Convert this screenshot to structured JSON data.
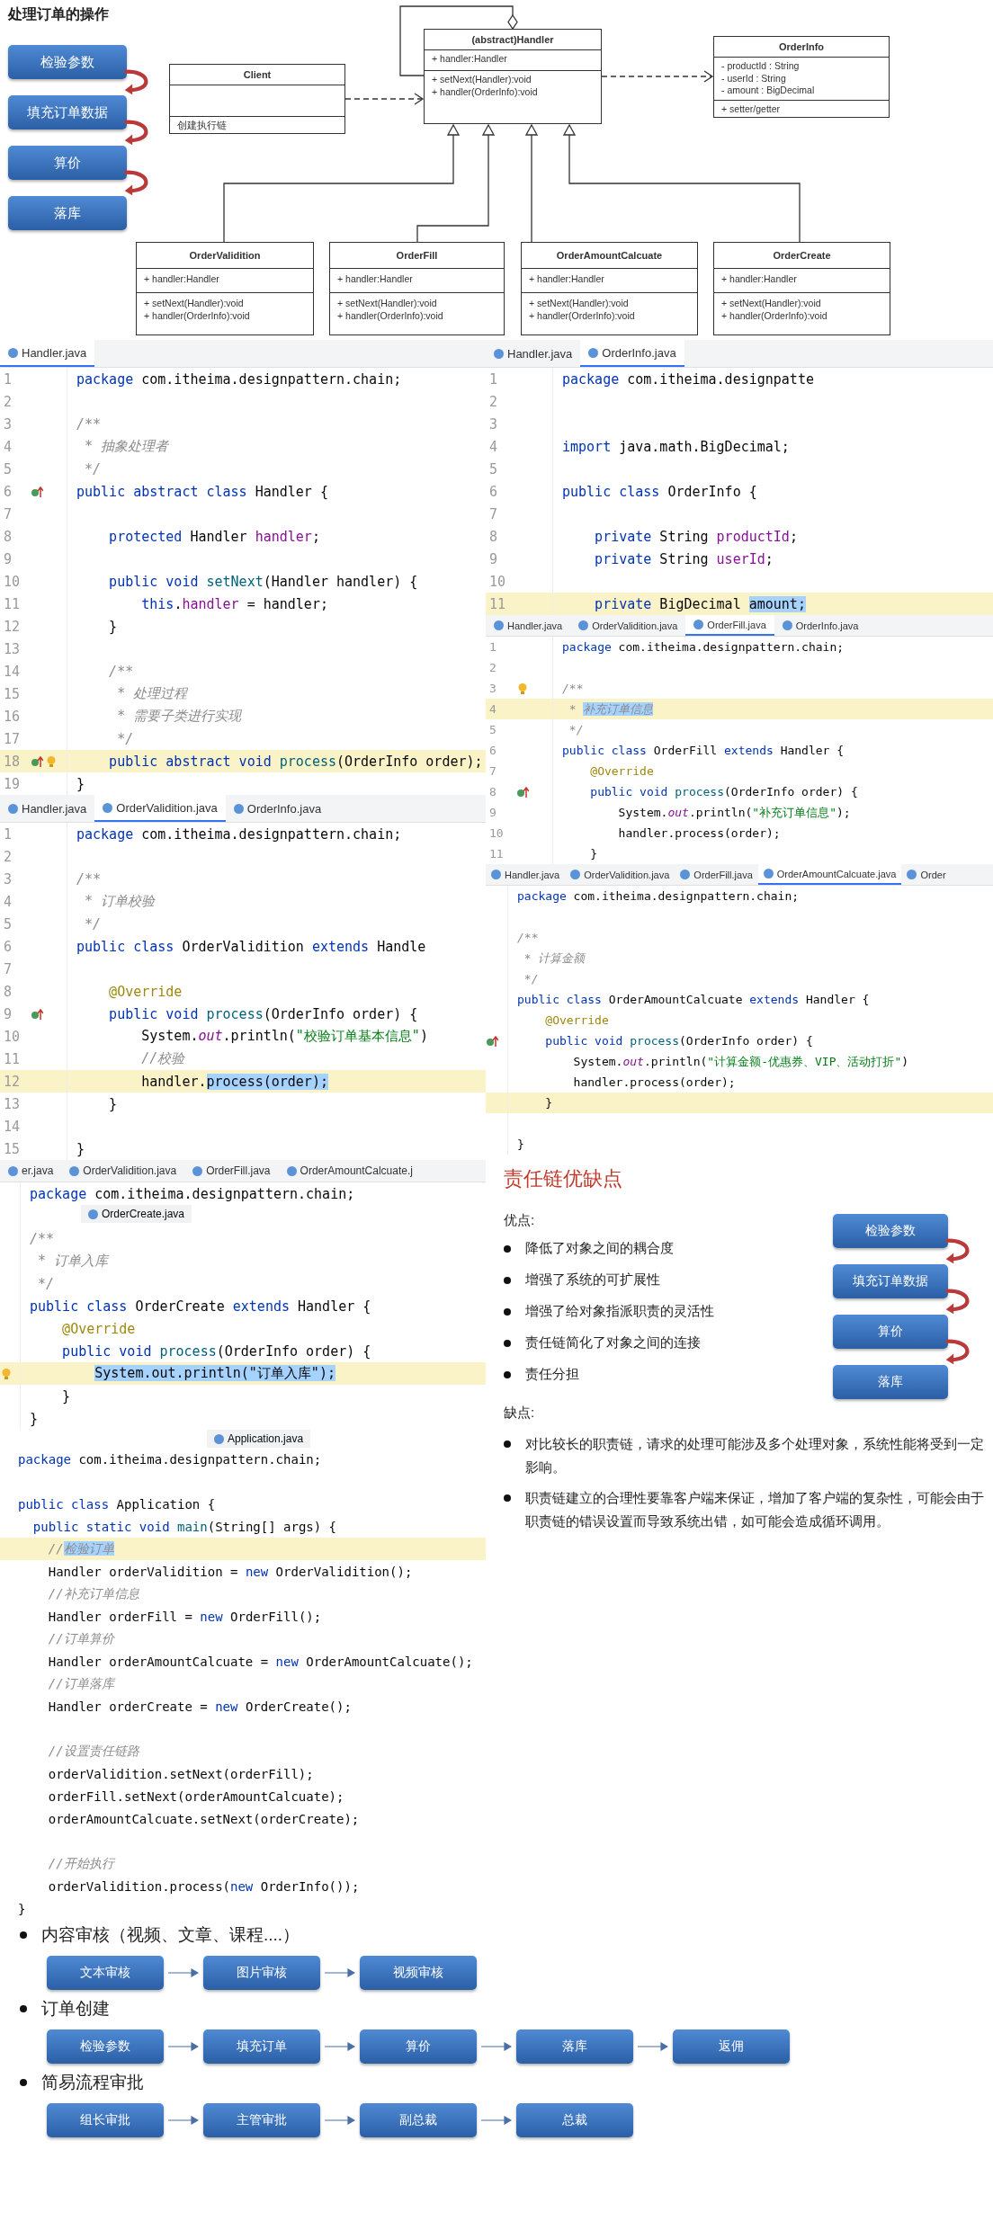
{
  "diagram": {
    "title": "处理订单的操作",
    "steps": [
      "检验参数",
      "填充订单数据",
      "算价",
      "落库"
    ],
    "classes": [
      {
        "name": "(abstract)Handler",
        "fields": [
          "+ handler:Handler"
        ],
        "methods": [
          "+ setNext(Handler):void",
          "+ handler(OrderInfo):void"
        ]
      },
      {
        "name": "Client",
        "methods": [
          "创建执行链"
        ]
      },
      {
        "name": "OrderInfo",
        "fields": [
          "- productId : String",
          "- userId : String",
          "- amount : BigDecimal"
        ],
        "methods": [
          "+ setter/getter"
        ]
      },
      {
        "name": "OrderValidition",
        "fields": [
          "+ handler:Handler"
        ],
        "methods": [
          "+ setNext(Handler):void",
          "+ handler(OrderInfo):void"
        ]
      },
      {
        "name": "OrderFill",
        "fields": [
          "+ handler:Handler"
        ],
        "methods": [
          "+ setNext(Handler):void",
          "+ handler(OrderInfo):void"
        ]
      },
      {
        "name": "OrderAmountCalcuate",
        "fields": [
          "+ handler:Handler"
        ],
        "methods": [
          "+ setNext(Handler):void",
          "+ handler(OrderInfo):void"
        ]
      },
      {
        "name": "OrderCreate",
        "fields": [
          "+ handler:Handler"
        ],
        "methods": [
          "+ setNext(Handler):void",
          "+ handler(OrderInfo):void"
        ]
      }
    ]
  },
  "left_column": {
    "editors": [
      {
        "tabs": [
          {
            "label": "Handler.java",
            "selected": true
          }
        ],
        "lines": [
          {
            "number": "1",
            "highlighted": false,
            "code": [
              {
                "kind": "keyword",
                "text": "package"
              },
              {
                "text": " com.itheima.designpattern.chain;"
              }
            ]
          },
          {
            "number": "2",
            "highlighted": false
          },
          {
            "number": "3",
            "highlighted": false,
            "code": [
              {
                "kind": "comment",
                "text": "/**"
              }
            ]
          },
          {
            "number": "4",
            "highlighted": false,
            "code": [
              {
                "kind": "comment",
                "text": " * 抽象处理者"
              }
            ]
          },
          {
            "number": "5",
            "highlighted": false,
            "code": [
              {
                "kind": "comment",
                "text": " */"
              }
            ]
          },
          {
            "number": "6",
            "highlighted": false,
            "markers": [
              {
                "kind": "override"
              }
            ],
            "code": [
              {
                "kind": "keyword",
                "text": "public abstract class"
              },
              {
                "text": " Handler {"
              }
            ]
          },
          {
            "number": "7",
            "highlighted": false
          },
          {
            "number": "8",
            "highlighted": false,
            "code": [
              {
                "kind": "keyword",
                "text": "    protected"
              },
              {
                "text": " Handler "
              },
              {
                "kind": "field",
                "text": "handler"
              },
              {
                "text": ";"
              }
            ]
          },
          {
            "number": "9",
            "highlighted": false
          },
          {
            "number": "10",
            "highlighted": false,
            "code": [
              {
                "kind": "keyword",
                "text": "    public void"
              },
              {
                "kind": "method",
                "text": " setNext"
              },
              {
                "text": "(Handler handler) {"
              }
            ]
          },
          {
            "number": "11",
            "highlighted": false,
            "code": [
              {
                "kind": "keyword",
                "text": "        this"
              },
              {
                "text": "."
              },
              {
                "kind": "field",
                "text": "handler"
              },
              {
                "text": " = handler;"
              }
            ]
          },
          {
            "number": "12",
            "highlighted": false,
            "code": [
              {
                "text": "    }"
              }
            ]
          },
          {
            "number": "13",
            "highlighted": false
          },
          {
            "number": "14",
            "highlighted": false,
            "code": [
              {
                "kind": "comment",
                "text": "    /**"
              }
            ]
          },
          {
            "number": "15",
            "highlighted": false,
            "code": [
              {
                "kind": "comment",
                "text": "     * 处理过程"
              }
            ]
          },
          {
            "number": "16",
            "highlighted": false,
            "code": [
              {
                "kind": "comment",
                "text": "     * 需要子类进行实现"
              }
            ]
          },
          {
            "number": "17",
            "highlighted": false,
            "code": [
              {
                "kind": "comment",
                "text": "     */"
              }
            ]
          },
          {
            "number": "18",
            "highlighted": true,
            "markers": [
              {
                "kind": "override"
              },
              {
                "kind": "bulb"
              }
            ],
            "code": [
              {
                "kind": "keyword",
                "text": "    public abstract void"
              },
              {
                "kind": "method",
                "text": " process"
              },
              {
                "text": "(OrderInfo order);"
              }
            ]
          },
          {
            "number": "19",
            "highlighted": false,
            "code": [
              {
                "text": "}"
              }
            ]
          }
        ]
      },
      {
        "tabs": [
          {
            "label": "Handler.java",
            "selected": false
          },
          {
            "label": "OrderValidition.java",
            "selected": true
          },
          {
            "label": "OrderInfo.java",
            "selected": false
          }
        ],
        "lines": [
          {
            "number": "1",
            "highlighted": false,
            "code": [
              {
                "kind": "keyword",
                "text": "package"
              },
              {
                "text": " com.itheima.designpattern.chain;"
              }
            ]
          },
          {
            "number": "2",
            "highlighted": false
          },
          {
            "number": "3",
            "highlighted": false,
            "code": [
              {
                "kind": "comment",
                "text": "/**"
              }
            ]
          },
          {
            "number": "4",
            "highlighted": false,
            "code": [
              {
                "kind": "comment",
                "text": " * 订单校验"
              }
            ]
          },
          {
            "number": "5",
            "highlighted": false,
            "code": [
              {
                "kind": "comment",
                "text": " */"
              }
            ]
          },
          {
            "number": "6",
            "highlighted": false,
            "code": [
              {
                "kind": "keyword",
                "text": "public class"
              },
              {
                "text": " OrderValidition "
              },
              {
                "kind": "keyword",
                "text": "extends"
              },
              {
                "text": " Handle"
              }
            ]
          },
          {
            "number": "7",
            "highlighted": false
          },
          {
            "number": "8",
            "highlighted": false,
            "code": [
              {
                "kind": "annotation",
                "text": "    @Override"
              }
            ]
          },
          {
            "number": "9",
            "highlighted": false,
            "markers": [
              {
                "kind": "override"
              }
            ],
            "code": [
              {
                "kind": "keyword",
                "text": "    public void"
              },
              {
                "kind": "method",
                "text": " process"
              },
              {
                "text": "(OrderInfo order) {"
              }
            ]
          },
          {
            "number": "10",
            "highlighted": false,
            "code": [
              {
                "text": "        System."
              },
              {
                "kind": "static",
                "text": "out"
              },
              {
                "text": ".println("
              },
              {
                "kind": "string",
                "text": "\"校验订单基本信息\""
              },
              {
                "text": ")"
              }
            ]
          },
          {
            "number": "11",
            "highlighted": false,
            "code": [
              {
                "kind": "comment",
                "text": "        //校验"
              }
            ]
          },
          {
            "number": "12",
            "highlighted": true,
            "code": [
              {
                "text": "        handler."
              },
              {
                "kind": "selection",
                "text": "process(order);"
              }
            ]
          },
          {
            "number": "13",
            "highlighted": false,
            "code": [
              {
                "text": "    }"
              }
            ]
          },
          {
            "number": "14",
            "highlighted": false
          },
          {
            "number": "15",
            "highlighted": false,
            "code": [
              {
                "text": "}"
              }
            ]
          }
        ]
      },
      {
        "tabs": [
          {
            "label": "er.java",
            "selected": false
          },
          {
            "label": "OrderValidition.java",
            "selected": false
          },
          {
            "label": "OrderFill.java",
            "selected": false
          },
          {
            "label": "OrderAmountCalcuate.j",
            "selected": false
          }
        ],
        "floating_tab": "OrderCreate.java",
        "lines": [
          {
            "highlighted": false,
            "code": [
              {
                "kind": "keyword",
                "text": "package"
              },
              {
                "text": " com.itheima.designpattern.chain;"
              }
            ]
          },
          {
            "highlighted": false
          },
          {
            "highlighted": false,
            "code": [
              {
                "kind": "comment",
                "text": "/**"
              }
            ]
          },
          {
            "highlighted": false,
            "code": [
              {
                "kind": "comment",
                "text": " * 订单入库"
              }
            ]
          },
          {
            "highlighted": false,
            "code": [
              {
                "kind": "comment",
                "text": " */"
              }
            ]
          },
          {
            "highlighted": false,
            "code": [
              {
                "kind": "keyword",
                "text": "public class"
              },
              {
                "text": " OrderCreate "
              },
              {
                "kind": "keyword",
                "text": "extends"
              },
              {
                "text": " Handler {"
              }
            ]
          },
          {
            "highlighted": false,
            "code": [
              {
                "kind": "annotation",
                "text": "    @Override"
              }
            ]
          },
          {
            "highlighted": false,
            "code": [
              {
                "kind": "keyword",
                "text": "    public void"
              },
              {
                "kind": "method",
                "text": " process"
              },
              {
                "text": "(OrderInfo order) {"
              }
            ]
          },
          {
            "highlighted": true,
            "markers": [
              {
                "kind": "bulb"
              }
            ],
            "code": [
              {
                "kind": "selection",
                "text": "        System.out.println(\"订单入库\");"
              }
            ]
          },
          {
            "highlighted": false,
            "code": [
              {
                "text": "    }"
              }
            ]
          },
          {
            "highlighted": false,
            "code": [
              {
                "text": "}"
              }
            ]
          }
        ]
      },
      {
        "floating_tab": "Application.java",
        "lines": [
          {
            "highlighted": false,
            "code": [
              {
                "kind": "keyword",
                "text": "package"
              },
              {
                "text": " com.itheima.designpattern.chain;"
              }
            ]
          },
          {
            "highlighted": false
          },
          {
            "highlighted": false,
            "code": [
              {
                "kind": "keyword",
                "text": "public class"
              },
              {
                "text": " Application {"
              }
            ]
          },
          {
            "highlighted": false,
            "code": [
              {
                "kind": "keyword",
                "text": "  public static void"
              },
              {
                "kind": "method",
                "text": " main"
              },
              {
                "text": "(String[] args) {"
              }
            ]
          },
          {
            "highlighted": true,
            "code": [
              {
                "kind": "comment",
                "text": "    //"
              },
              {
                "kind": "commentselection",
                "text": "检验订单"
              }
            ]
          },
          {
            "highlighted": false,
            "code": [
              {
                "text": "    Handler orderValidition = "
              },
              {
                "kind": "keyword",
                "text": "new"
              },
              {
                "text": " OrderValidition();"
              }
            ]
          },
          {
            "highlighted": false,
            "code": [
              {
                "kind": "comment",
                "text": "    //补充订单信息"
              }
            ]
          },
          {
            "highlighted": false,
            "code": [
              {
                "text": "    Handler orderFill = "
              },
              {
                "kind": "keyword",
                "text": "new"
              },
              {
                "text": " OrderFill();"
              }
            ]
          },
          {
            "highlighted": false,
            "code": [
              {
                "kind": "comment",
                "text": "    //订单算价"
              }
            ]
          },
          {
            "highlighted": false,
            "code": [
              {
                "text": "    Handler orderAmountCalcuate = "
              },
              {
                "kind": "keyword",
                "text": "new"
              },
              {
                "text": " OrderAmountCalcuate();"
              }
            ]
          },
          {
            "highlighted": false,
            "code": [
              {
                "kind": "comment",
                "text": "    //订单落库"
              }
            ]
          },
          {
            "highlighted": false,
            "code": [
              {
                "text": "    Handler orderCreate = "
              },
              {
                "kind": "keyword",
                "text": "new"
              },
              {
                "text": " OrderCreate();"
              }
            ]
          },
          {
            "highlighted": false
          },
          {
            "highlighted": false,
            "code": [
              {
                "kind": "comment",
                "text": "    //设置责任链路"
              }
            ]
          },
          {
            "highlighted": false,
            "code": [
              {
                "text": "    orderValidition.setNext(orderFill);"
              }
            ]
          },
          {
            "highlighted": false,
            "code": [
              {
                "text": "    orderFill.setNext(orderAmountCalcuate);"
              }
            ]
          },
          {
            "highlighted": false,
            "code": [
              {
                "text": "    orderAmountCalcuate.setNext(orderCreate);"
              }
            ]
          },
          {
            "highlighted": false
          },
          {
            "highlighted": false,
            "code": [
              {
                "kind": "comment",
                "text": "    //开始执行"
              }
            ]
          },
          {
            "highlighted": false,
            "code": [
              {
                "text": "    orderValidition.process("
              },
              {
                "kind": "keyword",
                "text": "new"
              },
              {
                "text": " OrderInfo());"
              }
            ]
          },
          {
            "highlighted": false,
            "code": [
              {
                "text": "}"
              }
            ]
          }
        ]
      }
    ]
  },
  "right_column": {
    "editors": [
      {
        "tabs": [
          {
            "label": "Handler.java",
            "selected": false
          },
          {
            "label": "OrderInfo.java",
            "selected": true
          }
        ],
        "lines": [
          {
            "number": "1",
            "highlighted": false,
            "code": [
              {
                "kind": "keyword",
                "text": "package"
              },
              {
                "text": " com.itheima.designpatte"
              }
            ]
          },
          {
            "number": "2",
            "highlighted": false
          },
          {
            "number": "3",
            "highlighted": false
          },
          {
            "number": "4",
            "highlighted": false,
            "code": [
              {
                "kind": "keyword",
                "text": "import"
              },
              {
                "text": " java.math.BigDecimal;"
              }
            ]
          },
          {
            "number": "5",
            "highlighted": false
          },
          {
            "number": "6",
            "highlighted": false,
            "code": [
              {
                "kind": "keyword",
                "text": "public class"
              },
              {
                "text": " OrderInfo {"
              }
            ]
          },
          {
            "number": "7",
            "highlighted": false
          },
          {
            "number": "8",
            "highlighted": false,
            "code": [
              {
                "kind": "keyword",
                "text": "    private"
              },
              {
                "text": " String "
              },
              {
                "kind": "field",
                "text": "productId"
              },
              {
                "text": ";"
              }
            ]
          },
          {
            "number": "9",
            "highlighted": false,
            "code": [
              {
                "kind": "keyword",
                "text": "    private"
              },
              {
                "text": " String "
              },
              {
                "kind": "field",
                "text": "userId"
              },
              {
                "text": ";"
              }
            ]
          },
          {
            "number": "10",
            "highlighted": false
          },
          {
            "number": "11",
            "highlighted": true,
            "code": [
              {
                "kind": "keyword",
                "text": "    private"
              },
              {
                "text": " BigDecimal "
              },
              {
                "kind": "selection",
                "text": "amount;"
              }
            ]
          }
        ]
      },
      {
        "tabs": [
          {
            "label": "Handler.java",
            "selected": false
          },
          {
            "label": "OrderValidition.java",
            "selected": false
          },
          {
            "label": "OrderFill.java",
            "selected": true
          },
          {
            "label": "OrderInfo.java",
            "selected": false
          }
        ],
        "lines": [
          {
            "number": "1",
            "highlighted": false,
            "code": [
              {
                "kind": "keyword",
                "text": "package"
              },
              {
                "text": " com.itheima.designpattern.chain;"
              }
            ]
          },
          {
            "number": "2",
            "highlighted": false
          },
          {
            "number": "3",
            "highlighted": false,
            "markers": [
              {
                "kind": "bulb"
              }
            ],
            "code": [
              {
                "kind": "comment",
                "text": "/**"
              }
            ]
          },
          {
            "number": "4",
            "highlighted": true,
            "code": [
              {
                "kind": "comment",
                "text": " * "
              },
              {
                "kind": "commentselection",
                "text": "补充订单信息"
              }
            ]
          },
          {
            "number": "5",
            "highlighted": false,
            "code": [
              {
                "kind": "comment",
                "text": " */"
              }
            ]
          },
          {
            "number": "6",
            "highlighted": false,
            "code": [
              {
                "kind": "keyword",
                "text": "public class"
              },
              {
                "text": " OrderFill "
              },
              {
                "kind": "keyword",
                "text": "extends"
              },
              {
                "text": " Handler {"
              }
            ]
          },
          {
            "number": "7",
            "highlighted": false,
            "code": [
              {
                "kind": "annotation",
                "text": "    @Override"
              }
            ]
          },
          {
            "number": "8",
            "highlighted": false,
            "markers": [
              {
                "kind": "override"
              }
            ],
            "code": [
              {
                "kind": "keyword",
                "text": "    public void"
              },
              {
                "kind": "method",
                "text": " process"
              },
              {
                "text": "(OrderInfo order) {"
              }
            ]
          },
          {
            "number": "9",
            "highlighted": false,
            "code": [
              {
                "text": "        System."
              },
              {
                "kind": "static",
                "text": "out"
              },
              {
                "text": ".println("
              },
              {
                "kind": "string",
                "text": "\"补充订单信息\""
              },
              {
                "text": ");"
              }
            ]
          },
          {
            "number": "10",
            "highlighted": false,
            "code": [
              {
                "text": "        handler.process(order);"
              }
            ]
          },
          {
            "number": "11",
            "highlighted": false,
            "code": [
              {
                "text": "    }"
              }
            ]
          }
        ]
      },
      {
        "tabs": [
          {
            "label": "Handler.java",
            "selected": false
          },
          {
            "label": "OrderValidition.java",
            "selected": false
          },
          {
            "label": "OrderFill.java",
            "selected": false
          },
          {
            "label": "OrderAmountCalcuate.java",
            "selected": true
          },
          {
            "label": "Order",
            "selected": false
          }
        ],
        "lines": [
          {
            "highlighted": false,
            "code": [
              {
                "kind": "keyword",
                "text": "package"
              },
              {
                "text": " com.itheima.designpattern.chain;"
              }
            ]
          },
          {
            "highlighted": false
          },
          {
            "highlighted": false,
            "code": [
              {
                "kind": "comment",
                "text": "/**"
              }
            ]
          },
          {
            "highlighted": false,
            "code": [
              {
                "kind": "comment",
                "text": " * 计算金额"
              }
            ]
          },
          {
            "highlighted": false,
            "code": [
              {
                "kind": "comment",
                "text": " */"
              }
            ]
          },
          {
            "highlighted": false,
            "code": [
              {
                "kind": "keyword",
                "text": "public class"
              },
              {
                "text": " OrderAmountCalcuate "
              },
              {
                "kind": "keyword",
                "text": "extends"
              },
              {
                "text": " Handler {"
              }
            ]
          },
          {
            "highlighted": false,
            "code": [
              {
                "kind": "annotation",
                "text": "    @Override"
              }
            ]
          },
          {
            "highlighted": false,
            "markers": [
              {
                "kind": "override"
              }
            ],
            "code": [
              {
                "kind": "keyword",
                "text": "    public void"
              },
              {
                "kind": "method",
                "text": " process"
              },
              {
                "text": "(OrderInfo order) {"
              }
            ]
          },
          {
            "highlighted": false,
            "code": [
              {
                "text": "        System."
              },
              {
                "kind": "static",
                "text": "out"
              },
              {
                "text": ".println("
              },
              {
                "kind": "string",
                "text": "\"计算金额-优惠券、VIP、活动打折\""
              },
              {
                "text": ")"
              }
            ]
          },
          {
            "highlighted": false,
            "code": [
              {
                "text": "        handler.process(order);"
              }
            ]
          },
          {
            "highlighted": true,
            "code": [
              {
                "text": "    }"
              }
            ]
          },
          {
            "highlighted": false
          },
          {
            "highlighted": false,
            "code": [
              {
                "text": "}"
              }
            ]
          }
        ]
      }
    ],
    "pros_cons": {
      "title": "责任链优缺点",
      "pros_label": "优点:",
      "pros": [
        "降低了对象之间的耦合度",
        "增强了系统的可扩展性",
        "增强了给对象指派职责的灵活性",
        "责任链简化了对象之间的连接",
        "责任分担"
      ],
      "steps": [
        "检验参数",
        "填充订单数据",
        "算价",
        "落库"
      ],
      "cons_label": "缺点:",
      "cons": [
        "对比较长的职责链，请求的处理可能涉及多个处理对象，系统性能将受到一定影响。",
        "职责链建立的合理性要靠客户端来保证，增加了客户端的复杂性，可能会由于职责链的错误设置而导致系统出错，如可能会造成循环调用。"
      ]
    }
  },
  "use_cases": [
    {
      "title": "内容审核（视频、文章、课程....）",
      "steps": [
        "文本审核",
        "图片审核",
        "视频审核"
      ]
    },
    {
      "title": "订单创建",
      "steps": [
        "检验参数",
        "填充订单",
        "算价",
        "落库",
        "返佣"
      ]
    },
    {
      "title": "简易流程审批",
      "steps": [
        "组长审批",
        "主管审批",
        "副总裁",
        "总裁"
      ]
    }
  ]
}
